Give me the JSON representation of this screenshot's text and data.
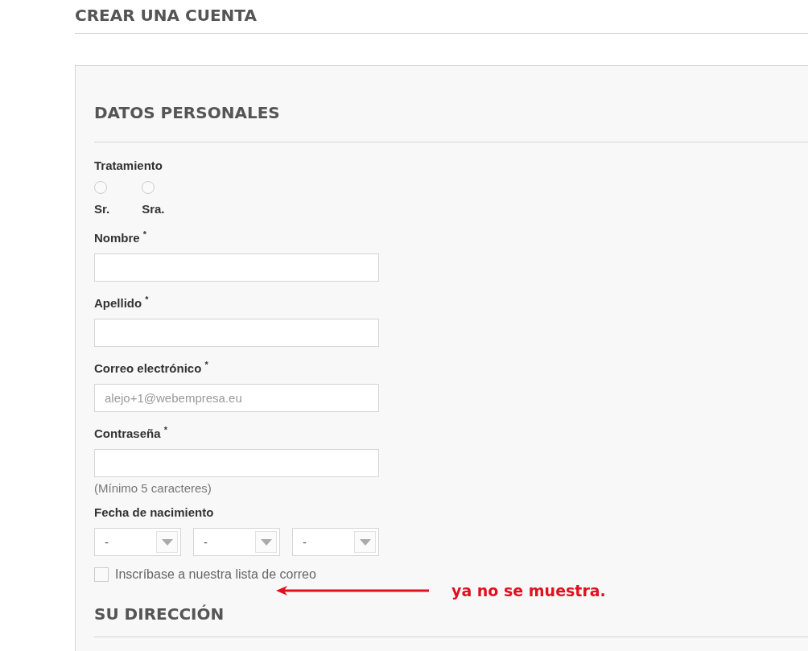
{
  "page_title": "CREAR UNA CUENTA",
  "personal": {
    "heading": "DATOS PERSONALES",
    "title_label": "Tratamiento",
    "title_options": [
      {
        "label": "Sr.",
        "selected": false
      },
      {
        "label": "Sra.",
        "selected": false
      }
    ],
    "fields": [
      {
        "label": "Nombre $^{*}$"
      },
      {
        "label": "Apellido $^{*}$"
      },
      {
        "label": "Correo electrónico $^{*}$",
        "placeholder": "alejo+1@webempresa.eu"
      },
      {
        "label": "Contraseña $^{*}$",
        "hint": "(Mínimo 5 caracteres)"
      }
    ],
    "birthdate_label": "Fecha de nacimiento",
    "birthdate_selects": [
      {
        "value": "-"
      },
      {
        "value": "-"
      },
      {
        "value": "-"
      }
    ],
    "newsletter": {
      "label": "Inscríbase a nuestra lista de correo",
      "checked": false
    }
  },
  "annotation": {
    "text": "ya no se muestra."
  },
  "address": {
    "heading": "SU DIRECCIÓN"
  }
}
